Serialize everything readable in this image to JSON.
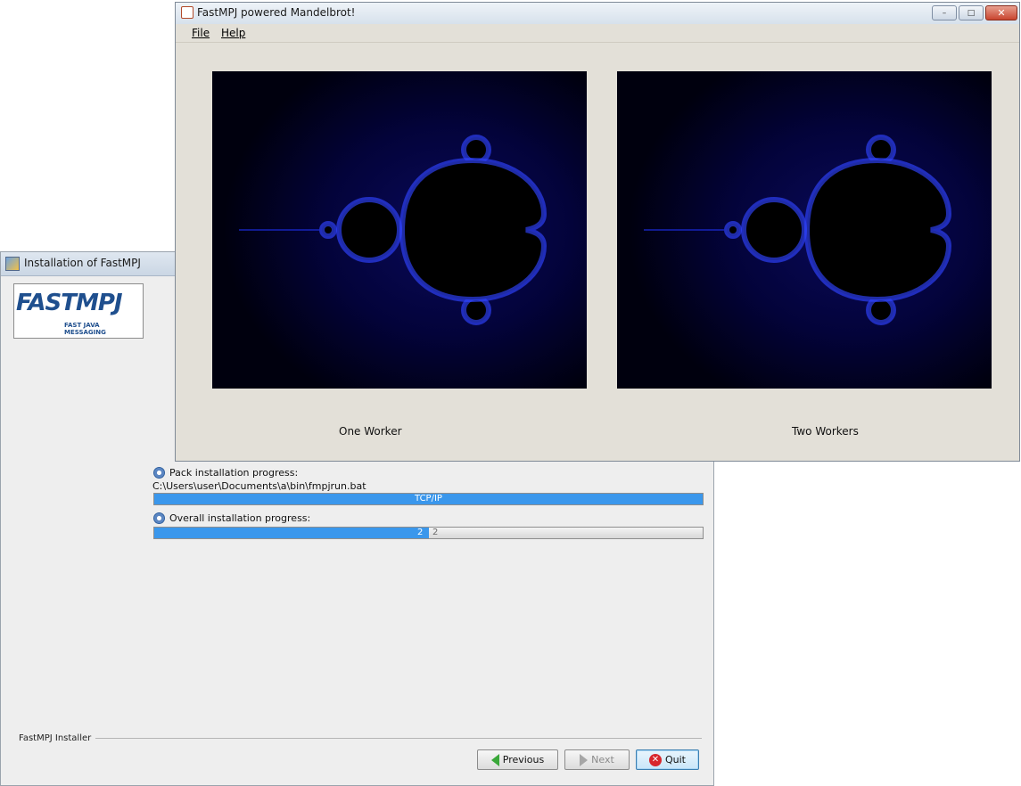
{
  "installer": {
    "title": "Installation of FastMPJ",
    "logo_text": "FASTMPJ",
    "logo_subtext": "FAST JAVA MESSAGING",
    "pack_progress_label": "Pack installation progress:",
    "current_file": "C:\\Users\\user\\Documents\\a\\bin\\fmpjrun.bat",
    "pack_progress_text": "TCP/IP",
    "pack_progress_fraction": 1.0,
    "overall_progress_label": "Overall installation progress:",
    "overall_progress_text_left": "2",
    "overall_progress_text_right": "2",
    "overall_progress_fraction": 0.5,
    "footer_label": "FastMPJ Installer",
    "buttons": {
      "previous": "Previous",
      "next": "Next",
      "quit": "Quit"
    }
  },
  "mandel": {
    "title": "FastMPJ powered Mandelbrot!",
    "window_buttons": {
      "minimize": "–",
      "maximize": "□",
      "close": "✕"
    },
    "menu": [
      {
        "label": "File"
      },
      {
        "label": "Help"
      }
    ],
    "panels": [
      {
        "caption": "One Worker"
      },
      {
        "caption": "Two Workers"
      }
    ]
  },
  "colors": {
    "progress_fill": "#3a97ec",
    "fractal_background": "#00000e",
    "fractal_edge": "#2233ff"
  }
}
